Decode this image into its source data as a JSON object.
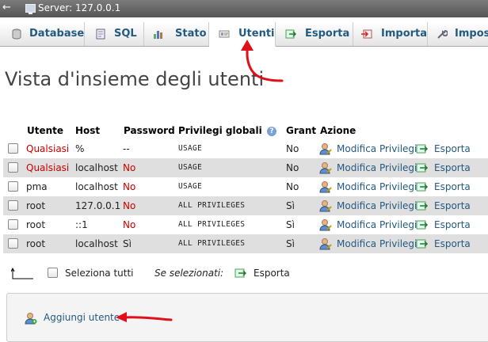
{
  "topbar": {
    "back": "←",
    "server_label": "Server: 127.0.0.1"
  },
  "tabs": [
    {
      "label": "Database",
      "icon": "database-icon"
    },
    {
      "label": "SQL",
      "icon": "sql-icon"
    },
    {
      "label": "Stato",
      "icon": "status-icon"
    },
    {
      "label": "Utenti",
      "icon": "users-icon",
      "active": true
    },
    {
      "label": "Esporta",
      "icon": "export-icon"
    },
    {
      "label": "Importa",
      "icon": "import-icon"
    },
    {
      "label": "Impos",
      "icon": "settings-icon"
    }
  ],
  "page_title": "Vista d'insieme degli utenti",
  "table": {
    "headers": {
      "user": "Utente",
      "host": "Host",
      "password": "Password",
      "privileges": "Privilegi globali",
      "grant": "Grant",
      "action": "Azione"
    },
    "help_icon": "?",
    "rows": [
      {
        "user": "Qualsiasi",
        "user_red": true,
        "host": "%",
        "password": "--",
        "password_red": false,
        "privileges": "USAGE",
        "grant": "No",
        "edit": "Modifica Privilegi",
        "export": "Esporta"
      },
      {
        "user": "Qualsiasi",
        "user_red": true,
        "host": "localhost",
        "password": "No",
        "password_red": true,
        "privileges": "USAGE",
        "grant": "No",
        "edit": "Modifica Privilegi",
        "export": "Esporta"
      },
      {
        "user": "pma",
        "user_red": false,
        "host": "localhost",
        "password": "No",
        "password_red": true,
        "privileges": "USAGE",
        "grant": "No",
        "edit": "Modifica Privilegi",
        "export": "Esporta"
      },
      {
        "user": "root",
        "user_red": false,
        "host": "127.0.0.1",
        "password": "No",
        "password_red": true,
        "privileges": "ALL PRIVILEGES",
        "grant": "Sì",
        "edit": "Modifica Privilegi",
        "export": "Esporta"
      },
      {
        "user": "root",
        "user_red": false,
        "host": "::1",
        "password": "No",
        "password_red": true,
        "privileges": "ALL PRIVILEGES",
        "grant": "Sì",
        "edit": "Modifica Privilegi",
        "export": "Esporta"
      },
      {
        "user": "root",
        "user_red": false,
        "host": "localhost",
        "password": "Sì",
        "password_red": false,
        "privileges": "ALL PRIVILEGES",
        "grant": "Sì",
        "edit": "Modifica Privilegi",
        "export": "Esporta"
      }
    ]
  },
  "selection": {
    "select_all": "Seleziona tutti",
    "with_selected": "Se selezionati:",
    "export": "Esporta"
  },
  "add_user": {
    "label": "Aggiungi utente"
  },
  "colors": {
    "link": "#235a81",
    "red": "#cc0000",
    "annotation": "#e0101a"
  }
}
